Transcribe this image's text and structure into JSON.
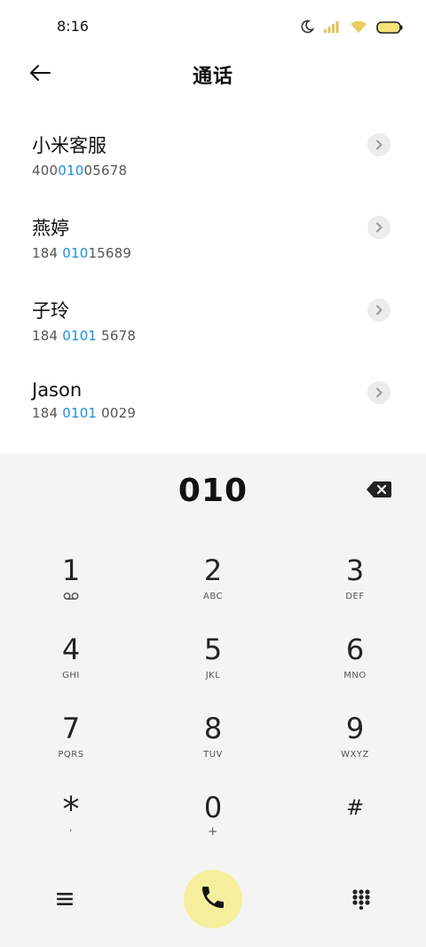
{
  "status_bar": {
    "time": "8:16"
  },
  "header": {
    "title": "通话"
  },
  "contacts": [
    {
      "name": "小米客服",
      "number_pre": "400",
      "number_match": "010",
      "number_post": "05678"
    },
    {
      "name": "燕婷",
      "number_pre": "184 ",
      "number_match": "010",
      "number_post": "15689"
    },
    {
      "name": "子玲",
      "number_pre": "184 ",
      "number_match": "0101",
      "number_post": " 5678"
    },
    {
      "name": "Jason",
      "number_pre": "184 ",
      "number_match": "0101",
      "number_post": " 0029"
    }
  ],
  "dialer": {
    "number": "010",
    "keys": [
      {
        "digit": "1",
        "letters": ""
      },
      {
        "digit": "2",
        "letters": "ABC"
      },
      {
        "digit": "3",
        "letters": "DEF"
      },
      {
        "digit": "4",
        "letters": "GHI"
      },
      {
        "digit": "5",
        "letters": "JKL"
      },
      {
        "digit": "6",
        "letters": "MNO"
      },
      {
        "digit": "7",
        "letters": "PQRS"
      },
      {
        "digit": "8",
        "letters": "TUV"
      },
      {
        "digit": "9",
        "letters": "WXYZ"
      },
      {
        "digit": "*",
        "letters": ","
      },
      {
        "digit": "0",
        "letters": "+"
      },
      {
        "digit": "#",
        "letters": ""
      }
    ]
  },
  "colors": {
    "highlight": "#1a8fe0",
    "call_button": "#f5ef9d",
    "dialer_bg": "#f4f4f4"
  },
  "icons": [
    "moon-icon",
    "signal-icon",
    "wifi-icon",
    "battery-icon",
    "back-arrow-icon",
    "chevron-right-icon",
    "voicemail-icon",
    "backspace-icon",
    "menu-icon",
    "phone-icon",
    "keypad-icon"
  ]
}
